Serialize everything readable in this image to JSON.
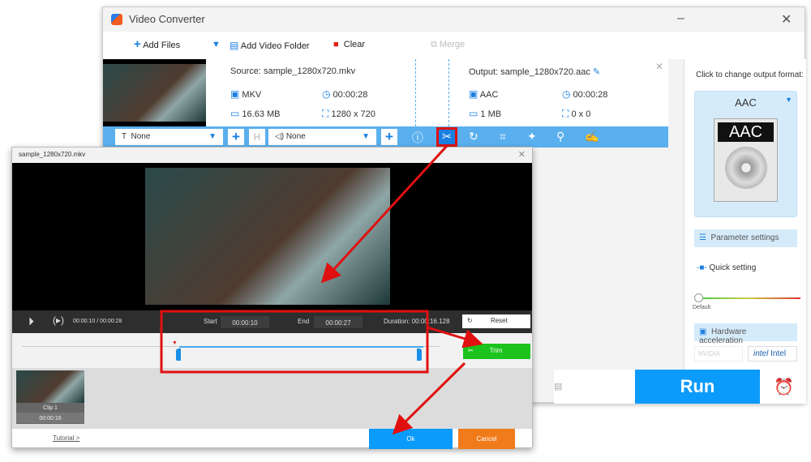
{
  "app": {
    "title": "Video Converter"
  },
  "toolbar": {
    "add_files": "Add Files",
    "add_folder": "Add Video Folder",
    "clear": "Clear",
    "merge": "Merge"
  },
  "source": {
    "label": "Source: sample_1280x720.mkv",
    "format": "MKV",
    "duration": "00:00:28",
    "size": "16.63 MB",
    "resolution": "1280 x 720"
  },
  "output": {
    "label": "Output: sample_1280x720.aac",
    "format": "AAC",
    "duration": "00:00:28",
    "size": "1 MB",
    "resolution": "0 x 0"
  },
  "edit_bar": {
    "subtitle": "None",
    "audio": "None"
  },
  "right_panel": {
    "hint": "Click to change output format:",
    "format": "AAC",
    "format_icon_text": "AAC",
    "param_settings": "Parameter settings",
    "quick_setting": "Quick setting",
    "slider_label": "Default",
    "slider_level": 0,
    "hw_accel": "Hardware acceleration",
    "nvidia": "NVIDIA",
    "intel": "Intel"
  },
  "run": "Run",
  "dialog": {
    "title": "sample_1280x720.mkv",
    "time": "00:00:10",
    "total": "00:00:28",
    "start_label": "Start",
    "start": "00:00:10",
    "end_label": "End",
    "end": "00:00:27",
    "duration_label": "Duration:",
    "duration": "00:00:16.128",
    "reset": "Reset",
    "trim": "Trim",
    "clip_name": "Clip 1",
    "clip_duration": "00:00:16",
    "tutorial": "Tutorial >",
    "ok": "Ok",
    "cancel": "Cancel"
  },
  "colors": {
    "accent": "#0b9bfb",
    "trim": "#1cc31c",
    "cancel": "#f07b1a",
    "annotation": "#e01010"
  }
}
